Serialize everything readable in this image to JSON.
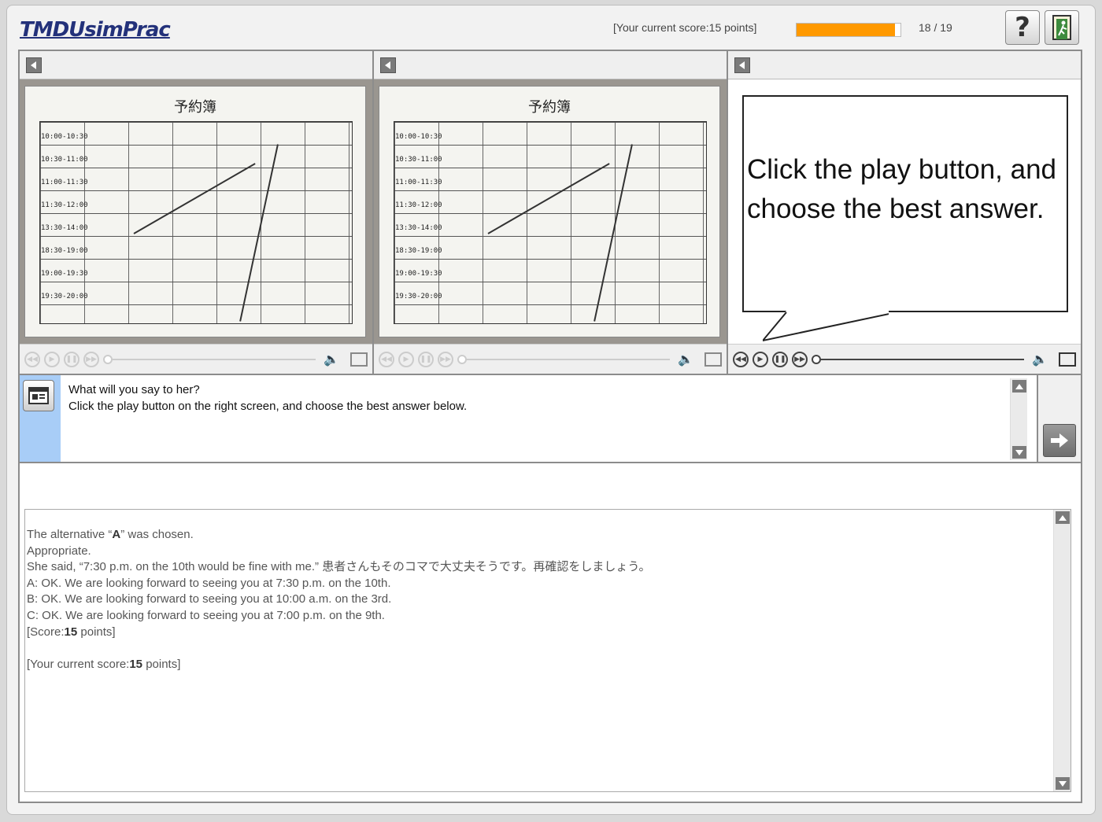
{
  "app": {
    "logo": "TMDUsimPrac",
    "score_text": "[Your current score:15 points]",
    "progress": 0.95,
    "page_count": "18 / 19",
    "help_label": "?"
  },
  "panels": [
    {
      "sheet_title": "予約簿",
      "slots": [
        "10:00-10:30",
        "10:30-11:00",
        "11:00-11:30",
        "11:30-12:00",
        "13:30-14:00",
        "18:30-19:00",
        "19:00-19:30",
        "19:30-20:00"
      ]
    },
    {
      "sheet_title": "予約簿",
      "slots": [
        "10:00-10:30",
        "10:30-11:00",
        "11:00-11:30",
        "11:30-12:00",
        "13:30-14:00",
        "18:30-19:00",
        "19:00-19:30",
        "19:30-20:00"
      ]
    },
    {
      "bubble_text": "Click the play button, and choose the best answer."
    }
  ],
  "question": {
    "line1": "What will you say to her?",
    "line2": "Click the play button on the right screen, and choose the best answer below."
  },
  "feedback": {
    "chosen_prefix": "The alternative “",
    "chosen_value": "A",
    "chosen_suffix": "” was chosen.",
    "result": "Appropriate.",
    "explanation": "She said, “7:30 p.m. on the 10th would be fine with me.” 患者さんもそのコマで大丈夫そうです。再確認をしましょう。",
    "option_a": "A: OK. We are looking forward to seeing you at 7:30 p.m. on the 10th.",
    "option_b": "B: OK. We are looking forward to seeing you at 10:00 a.m. on the 3rd.",
    "option_c": "C: OK. We are looking forward to seeing you at 7:00 p.m. on the 9th.",
    "score_prefix": "[Score:",
    "score_value": "15",
    "score_suffix": " points]",
    "current_prefix": "[Your current score:",
    "current_value": "15",
    "current_suffix": " points]"
  },
  "colors": {
    "progress_fill": "#ff9900",
    "question_side": "#a8cdf7",
    "logo": "#23317a"
  },
  "icons": [
    "help-icon",
    "exit-icon",
    "back-arrow-icon",
    "rewind-icon",
    "play-icon",
    "pause-icon",
    "fast-forward-icon",
    "volume-icon",
    "popout-icon",
    "document-icon",
    "next-arrow-icon",
    "scroll-up-icon",
    "scroll-down-icon"
  ]
}
